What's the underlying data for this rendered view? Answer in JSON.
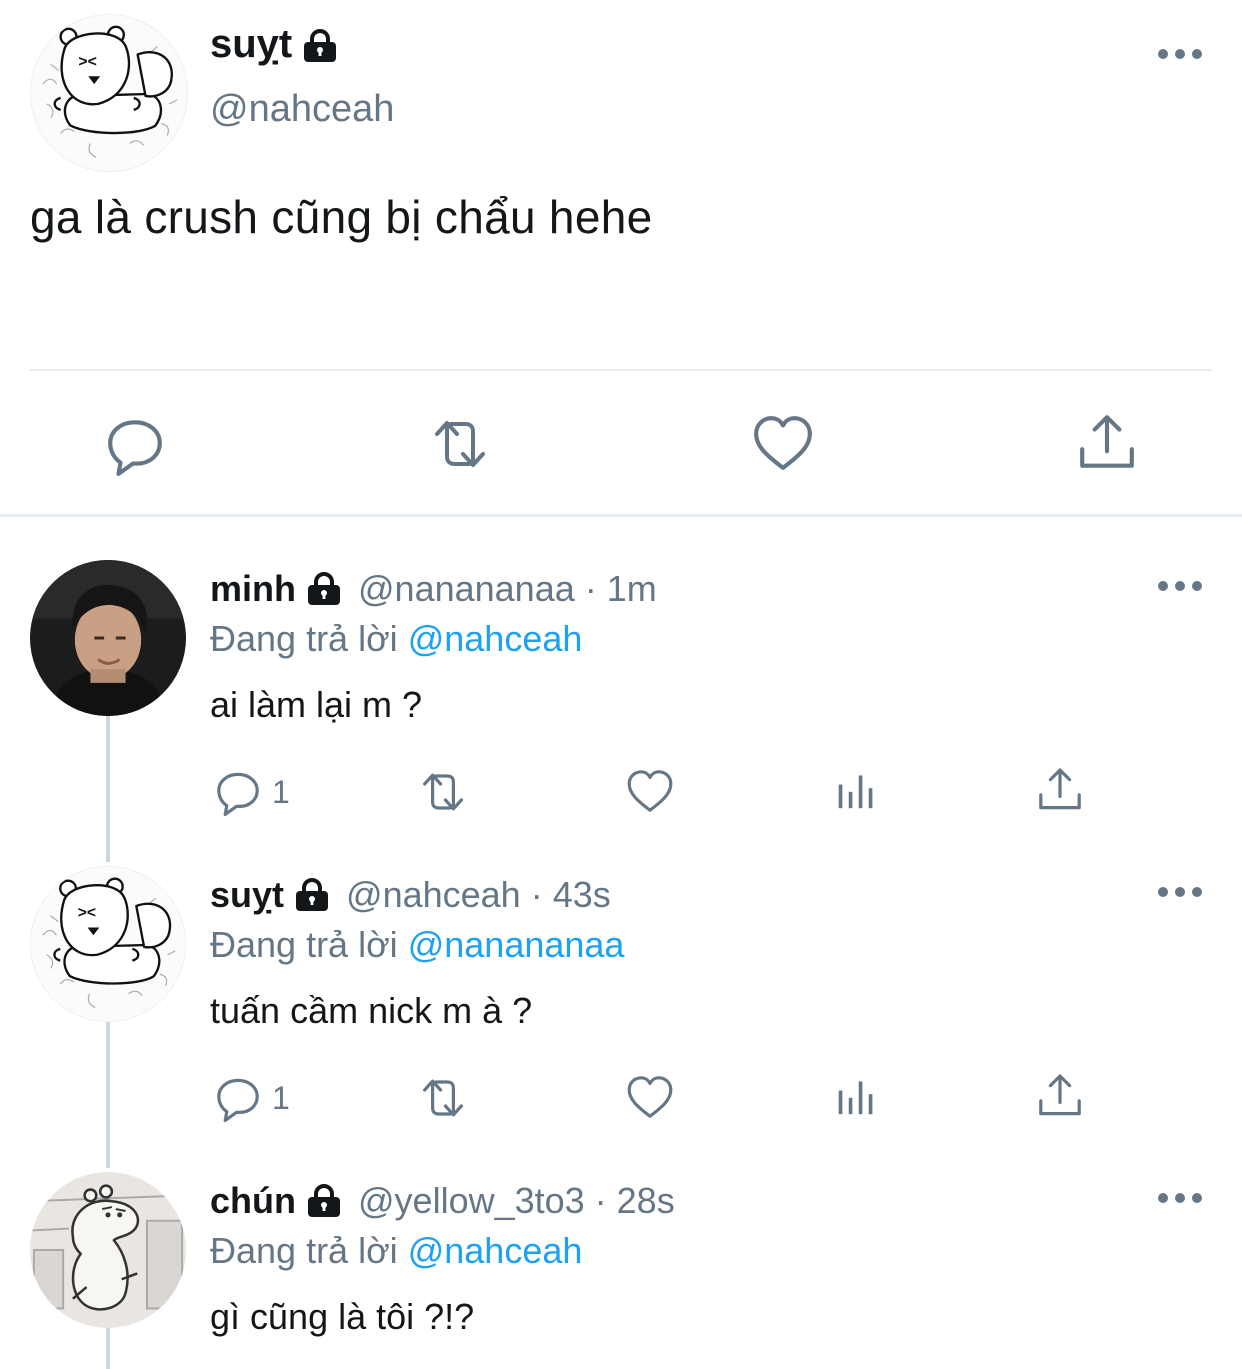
{
  "main_tweet": {
    "name": "suỵt",
    "handle": "@nahceah",
    "text": "ga là crush cũng bị chẩu hehe"
  },
  "replies": [
    {
      "name": "minh",
      "handle": "@nanananaa",
      "time": "· 1m",
      "replying_prefix": "Đang trả lời",
      "replying_to": "@nahceah",
      "text": "ai làm lại m ?",
      "reply_count": "1"
    },
    {
      "name": "suỵt",
      "handle": "@nahceah",
      "time": "· 43s",
      "replying_prefix": "Đang trả lời",
      "replying_to": "@nanananaa",
      "text": "tuấn cầm nick m à ?",
      "reply_count": "1"
    },
    {
      "name": "chún",
      "handle": "@yellow_3to3",
      "time": "· 28s",
      "replying_prefix": "Đang trả lời",
      "replying_to": "@nahceah",
      "text": "gì cũng là tôi ?!?"
    }
  ],
  "icons": {
    "lock": "lock-icon",
    "more": "more-icon",
    "reply": "reply-icon",
    "retweet": "retweet-icon",
    "like": "heart-icon",
    "share": "share-icon",
    "analytics": "analytics-icon"
  },
  "colors": {
    "text": "#14171a",
    "secondary": "#657786",
    "link": "#1da1f2",
    "divider": "#e6ecf0"
  }
}
